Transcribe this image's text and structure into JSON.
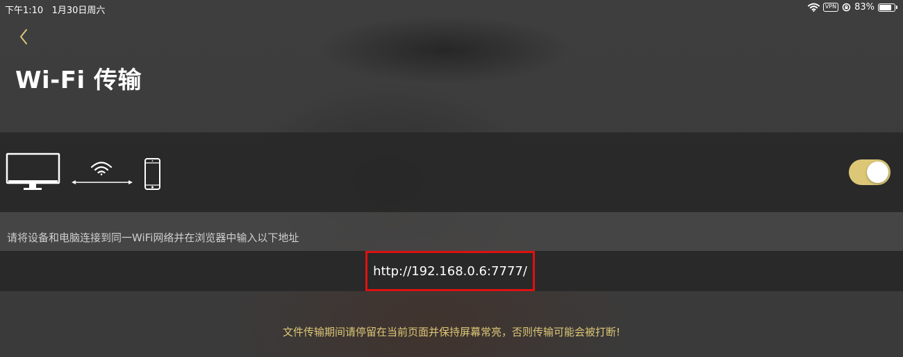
{
  "status_bar": {
    "time": "下午1:10",
    "date": "1月30日周六",
    "vpn": "VPN",
    "battery": "83%",
    "battery_level": 0.83
  },
  "header": {
    "title": "Wi-Fi 传输"
  },
  "transfer": {
    "toggle_on": true
  },
  "instruction": "请将设备和电脑连接到同一WiFi网络并在浏览器中输入以下地址",
  "url": "http://192.168.0.6:7777/",
  "warning": "文件传输期间请停留在当前页面并保持屏幕常亮，否则传输可能会被打断!",
  "colors": {
    "accent": "#dcc777",
    "highlight_border": "#e01010",
    "panel": "#282828"
  },
  "icons": {
    "back": "chevron-left-icon",
    "monitor": "monitor-icon",
    "wifi": "wifi-icon",
    "transfer_arrow": "double-arrow-icon",
    "phone": "phone-icon"
  }
}
